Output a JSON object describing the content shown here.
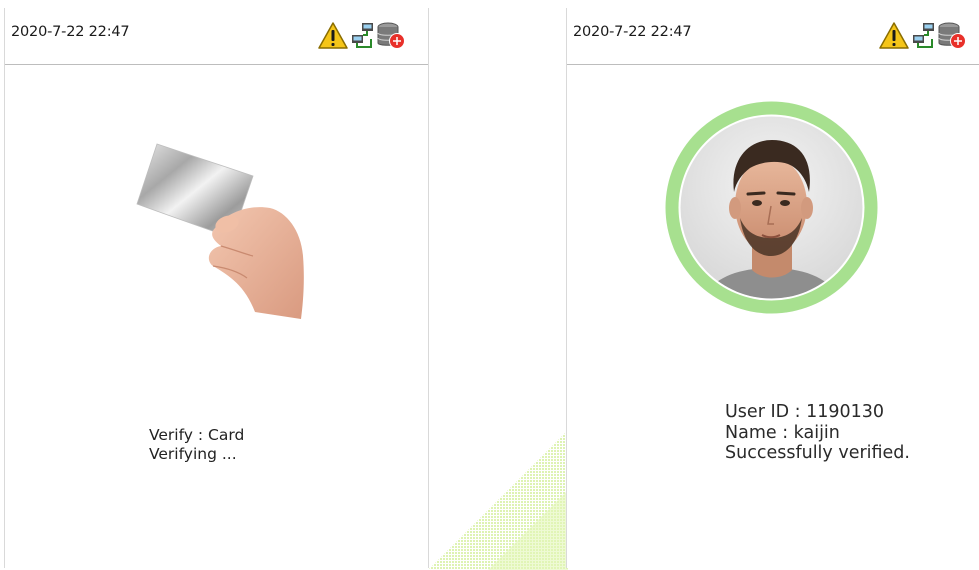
{
  "left_screen": {
    "datetime": "2020-7-22 22:47",
    "status_icons": [
      "warning-icon",
      "network-icon",
      "database-icon"
    ],
    "verify_mode": "Verify : Card",
    "status_text": "Verifying ..."
  },
  "right_screen": {
    "datetime": "2020-7-22 22:47",
    "status_icons": [
      "warning-icon",
      "network-icon",
      "database-icon"
    ],
    "user_id": "User ID : 1190130",
    "name": "Name : kaijin",
    "result": "Successfully verified."
  },
  "colors": {
    "warning": "#f5c518",
    "success_ring": "#a7e08f",
    "error_badge": "#e8302a"
  }
}
